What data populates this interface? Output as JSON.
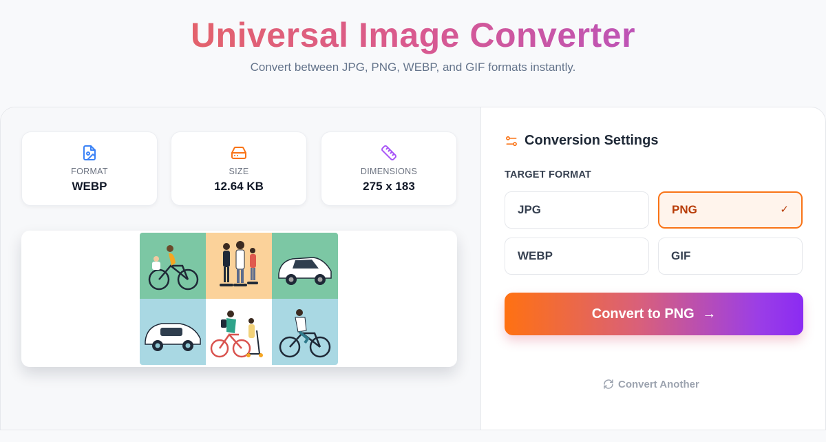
{
  "header": {
    "title": "Universal Image Converter",
    "subtitle": "Convert between JPG, PNG, WEBP, and GIF formats instantly."
  },
  "stats": [
    {
      "label": "FORMAT",
      "value": "WEBP",
      "icon": "image-file-icon",
      "color": "#3b82f6"
    },
    {
      "label": "SIZE",
      "value": "12.64 KB",
      "icon": "hard-drive-icon",
      "color": "#f97316"
    },
    {
      "label": "DIMENSIONS",
      "value": "275 x 183",
      "icon": "ruler-icon",
      "color": "#a855f7"
    }
  ],
  "preview": {
    "tiles": [
      "woman-cycling-child-seat",
      "family-on-hoverboards",
      "white-electric-car",
      "white-car-side",
      "couple-bike-and-scooter",
      "man-on-bicycle"
    ],
    "tile_colors": [
      "#7cc7a4",
      "#fbd29a",
      "#7cc7a4",
      "#a9d8e3",
      "#ffffff",
      "#a9d8e3"
    ]
  },
  "settings": {
    "title": "Conversion Settings",
    "icon": "sliders-icon",
    "target_label": "TARGET FORMAT",
    "options": [
      {
        "label": "JPG",
        "selected": false
      },
      {
        "label": "PNG",
        "selected": true
      },
      {
        "label": "WEBP",
        "selected": false
      },
      {
        "label": "GIF",
        "selected": false
      }
    ],
    "check": "✓",
    "convert_label": "Convert to PNG",
    "convert_arrow": "→",
    "another_label": "Convert Another",
    "accent": "#f97316"
  }
}
